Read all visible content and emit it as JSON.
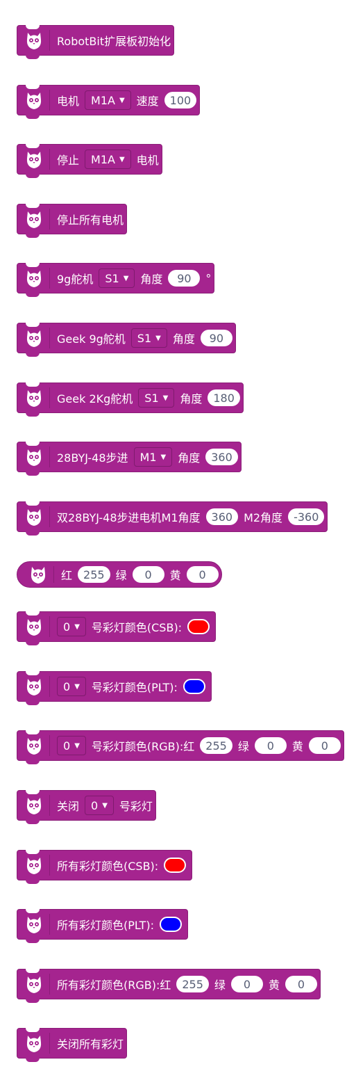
{
  "colors": {
    "block": "#A5248F",
    "block_border": "#8A1C77",
    "number_text": "#575E75",
    "red": "#FF0000",
    "blue": "#0000FF"
  },
  "icon_name": "robotbit-owl-icon",
  "blocks": [
    {
      "id": "init",
      "parts": [
        {
          "t": "label",
          "v": "RobotBit扩展板初始化"
        }
      ]
    },
    {
      "id": "motor-run",
      "parts": [
        {
          "t": "label",
          "v": "电机"
        },
        {
          "t": "dd",
          "v": "M1A"
        },
        {
          "t": "label",
          "v": "速度"
        },
        {
          "t": "num",
          "v": "100"
        }
      ]
    },
    {
      "id": "motor-stop",
      "parts": [
        {
          "t": "label",
          "v": "停止"
        },
        {
          "t": "dd",
          "v": "M1A"
        },
        {
          "t": "label",
          "v": "电机"
        }
      ]
    },
    {
      "id": "stop-all-motors",
      "parts": [
        {
          "t": "label",
          "v": "停止所有电机"
        }
      ]
    },
    {
      "id": "servo-9g",
      "parts": [
        {
          "t": "label",
          "v": "9g舵机"
        },
        {
          "t": "dd",
          "v": "S1"
        },
        {
          "t": "label",
          "v": "角度"
        },
        {
          "t": "num",
          "v": "90"
        },
        {
          "t": "label",
          "v": "°"
        }
      ]
    },
    {
      "id": "geek-servo-9g",
      "parts": [
        {
          "t": "label",
          "v": "Geek 9g舵机"
        },
        {
          "t": "dd",
          "v": "S1"
        },
        {
          "t": "label",
          "v": "角度"
        },
        {
          "t": "num",
          "v": "90"
        }
      ]
    },
    {
      "id": "geek-servo-2kg",
      "parts": [
        {
          "t": "label",
          "v": "Geek 2Kg舵机"
        },
        {
          "t": "dd",
          "v": "S1"
        },
        {
          "t": "label",
          "v": "角度"
        },
        {
          "t": "num",
          "v": "180"
        }
      ]
    },
    {
      "id": "stepper",
      "parts": [
        {
          "t": "label",
          "v": "28BYJ-48步进"
        },
        {
          "t": "dd",
          "v": "M1"
        },
        {
          "t": "label",
          "v": "角度"
        },
        {
          "t": "num",
          "v": "360"
        }
      ]
    },
    {
      "id": "dual-stepper",
      "parts": [
        {
          "t": "label",
          "v": "双28BYJ-48步进电机M1角度"
        },
        {
          "t": "num",
          "v": "360"
        },
        {
          "t": "label",
          "v": "M2角度"
        },
        {
          "t": "num",
          "v": "-360"
        }
      ]
    },
    {
      "id": "rgb-reporter",
      "reporter": true,
      "parts": [
        {
          "t": "label",
          "v": "红"
        },
        {
          "t": "num",
          "v": "255"
        },
        {
          "t": "label",
          "v": "绿"
        },
        {
          "t": "num",
          "v": "0"
        },
        {
          "t": "label",
          "v": "黄"
        },
        {
          "t": "num",
          "v": "0"
        }
      ]
    },
    {
      "id": "led-color-csb",
      "parts": [
        {
          "t": "dd",
          "v": "0"
        },
        {
          "t": "label",
          "v": "号彩灯颜色(CSB):"
        },
        {
          "t": "color",
          "v": "red"
        }
      ]
    },
    {
      "id": "led-color-plt",
      "parts": [
        {
          "t": "dd",
          "v": "0"
        },
        {
          "t": "label",
          "v": "号彩灯颜色(PLT):"
        },
        {
          "t": "color",
          "v": "blue"
        }
      ]
    },
    {
      "id": "led-color-rgb",
      "parts": [
        {
          "t": "dd",
          "v": "0"
        },
        {
          "t": "label",
          "v": "号彩灯颜色(RGB):红"
        },
        {
          "t": "num",
          "v": "255"
        },
        {
          "t": "label",
          "v": "绿"
        },
        {
          "t": "num",
          "v": "0"
        },
        {
          "t": "label",
          "v": "黄"
        },
        {
          "t": "num",
          "v": "0"
        }
      ]
    },
    {
      "id": "led-off",
      "parts": [
        {
          "t": "label",
          "v": "关闭"
        },
        {
          "t": "dd",
          "v": "0"
        },
        {
          "t": "label",
          "v": "号彩灯"
        }
      ]
    },
    {
      "id": "all-leds-csb",
      "parts": [
        {
          "t": "label",
          "v": "所有彩灯颜色(CSB):"
        },
        {
          "t": "color",
          "v": "red"
        }
      ]
    },
    {
      "id": "all-leds-plt",
      "parts": [
        {
          "t": "label",
          "v": "所有彩灯颜色(PLT):"
        },
        {
          "t": "color",
          "v": "blue"
        }
      ]
    },
    {
      "id": "all-leds-rgb",
      "parts": [
        {
          "t": "label",
          "v": "所有彩灯颜色(RGB):红"
        },
        {
          "t": "num",
          "v": "255"
        },
        {
          "t": "label",
          "v": "绿"
        },
        {
          "t": "num",
          "v": "0"
        },
        {
          "t": "label",
          "v": "黄"
        },
        {
          "t": "num",
          "v": "0"
        }
      ]
    },
    {
      "id": "all-leds-off",
      "parts": [
        {
          "t": "label",
          "v": "关闭所有彩灯"
        }
      ]
    }
  ]
}
